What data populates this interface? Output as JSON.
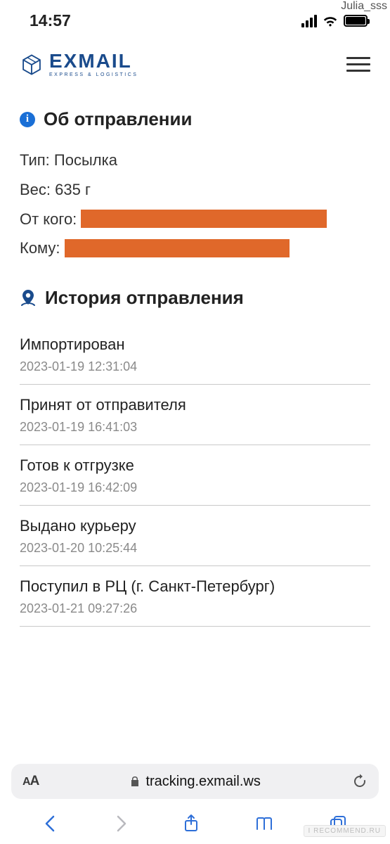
{
  "corner_name": "Julia_sss",
  "status": {
    "time": "14:57"
  },
  "brand": {
    "name": "EXMAIL",
    "tagline": "EXPRESS & LOGISTICS"
  },
  "about": {
    "title": "Об отправлении",
    "type_label": "Тип:",
    "type_value": "Посылка",
    "weight_label": "Вес:",
    "weight_value": "635 г",
    "from_label": "От кого:",
    "to_label": "Кому:"
  },
  "history": {
    "title": "История отправления",
    "items": [
      {
        "status": "Импортирован",
        "ts": "2023-01-19 12:31:04"
      },
      {
        "status": "Принят от отправителя",
        "ts": "2023-01-19 16:41:03"
      },
      {
        "status": "Готов к отгрузке",
        "ts": "2023-01-19 16:42:09"
      },
      {
        "status": "Выдано курьеру",
        "ts": "2023-01-20 10:25:44"
      },
      {
        "status": "Поступил в РЦ (г. Санкт-Петербург)",
        "ts": "2023-01-21 09:27:26"
      }
    ]
  },
  "browser": {
    "aa": "AA",
    "url": "tracking.exmail.ws"
  },
  "watermark": "I RECOMMEND.RU"
}
